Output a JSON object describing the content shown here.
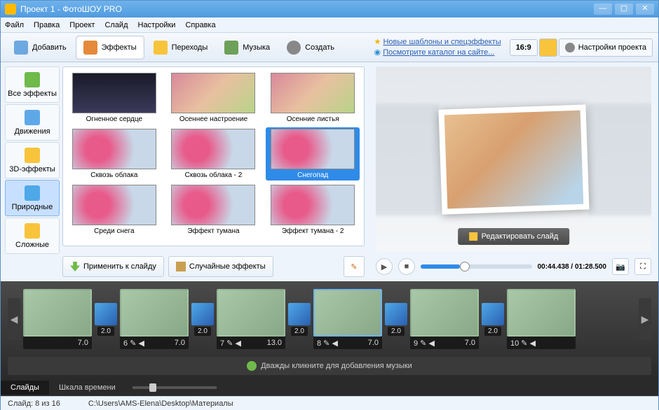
{
  "title": "Проект 1 - ФотоШОУ PRO",
  "menu": [
    "Файл",
    "Правка",
    "Проект",
    "Слайд",
    "Настройки",
    "Справка"
  ],
  "toolbar": {
    "add": "Добавить",
    "fx": "Эффекты",
    "trans": "Переходы",
    "music": "Музыка",
    "create": "Создать"
  },
  "links": {
    "l1": "Новые шаблоны и спецэффекты",
    "l2": "Посмотрите каталог на сайте..."
  },
  "ratio": "16:9",
  "settings": "Настройки проекта",
  "cats": [
    {
      "label": "Все эффекты"
    },
    {
      "label": "Движения"
    },
    {
      "label": "3D-эффекты"
    },
    {
      "label": "Природные"
    },
    {
      "label": "Сложные"
    }
  ],
  "effects": [
    {
      "label": "Огненное сердце",
      "cls": "dark"
    },
    {
      "label": "Осеннее настроение",
      "cls": ""
    },
    {
      "label": "Осенние листья",
      "cls": ""
    },
    {
      "label": "Сквозь облака",
      "cls": "flower"
    },
    {
      "label": "Сквозь облака - 2",
      "cls": "flower"
    },
    {
      "label": "Снегопад",
      "cls": "flower",
      "sel": true
    },
    {
      "label": "Среди снега",
      "cls": "flower"
    },
    {
      "label": "Эффект тумана",
      "cls": "flower"
    },
    {
      "label": "Эффект тумана - 2",
      "cls": "flower"
    }
  ],
  "apply": "Применить к слайду",
  "random": "Случайные эффекты",
  "edit_slide": "Редактировать слайд",
  "time": "00:44.438 / 01:28.500",
  "slides": [
    {
      "n": "",
      "dur": "7.0",
      "tr": "2.0"
    },
    {
      "n": "6",
      "dur": "7.0",
      "tr": "2.0"
    },
    {
      "n": "7",
      "dur": "13.0",
      "tr": "2.0"
    },
    {
      "n": "8",
      "dur": "7.0",
      "tr": "2.0",
      "sel": true
    },
    {
      "n": "9",
      "dur": "7.0",
      "tr": "2.0"
    },
    {
      "n": "10",
      "dur": "",
      "tr": ""
    }
  ],
  "music_hint": "Дважды кликните для добавления музыки",
  "tabs": {
    "slides": "Слайды",
    "timeline": "Шкала времени"
  },
  "status": {
    "slide": "Слайд: 8 из 16",
    "path": "C:\\Users\\AMS-Elena\\Desktop\\Материалы"
  }
}
